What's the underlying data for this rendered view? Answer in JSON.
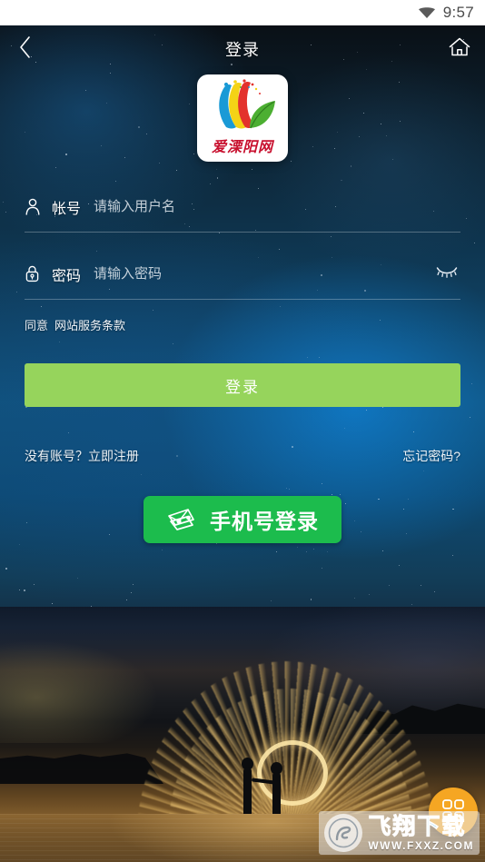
{
  "status_bar": {
    "time": "9:57",
    "wifi_icon": "wifi-icon"
  },
  "header": {
    "back_icon": "chevron-left-icon",
    "title": "登录",
    "home_icon": "home-icon"
  },
  "logo": {
    "brand_text": "爱溧阳网",
    "alt": "app-logo"
  },
  "form": {
    "account": {
      "icon": "person-icon",
      "label": "帐号",
      "value": "",
      "placeholder": "请输入用户名"
    },
    "password": {
      "icon": "lock-icon",
      "label": "密码",
      "value": "",
      "placeholder": "请输入密码",
      "toggle_icon": "eye-closed-icon"
    }
  },
  "agreement": {
    "prefix": "同意",
    "terms_link": "网站服务条款"
  },
  "buttons": {
    "login": "登录",
    "phone_login": "手机号登录",
    "phone_login_icon": "message-cards-icon"
  },
  "links": {
    "register": "没有账号？立即注册",
    "forgot": "忘记密码?"
  },
  "fab": {
    "icon": "grid-icon"
  },
  "watermark": {
    "badge_icon": "fxxz-logo-icon",
    "title": "飞翔下载",
    "url": "WWW.FXXZ.COM"
  },
  "colors": {
    "login_button": "#96d45c",
    "phone_button": "#1cbc4d",
    "fab": "#f5a623",
    "watermark_text": "#29a7e8",
    "logo_text": "#c8102e",
    "status_bar_bg": "#ffffff",
    "status_text": "#4a4a4a"
  }
}
